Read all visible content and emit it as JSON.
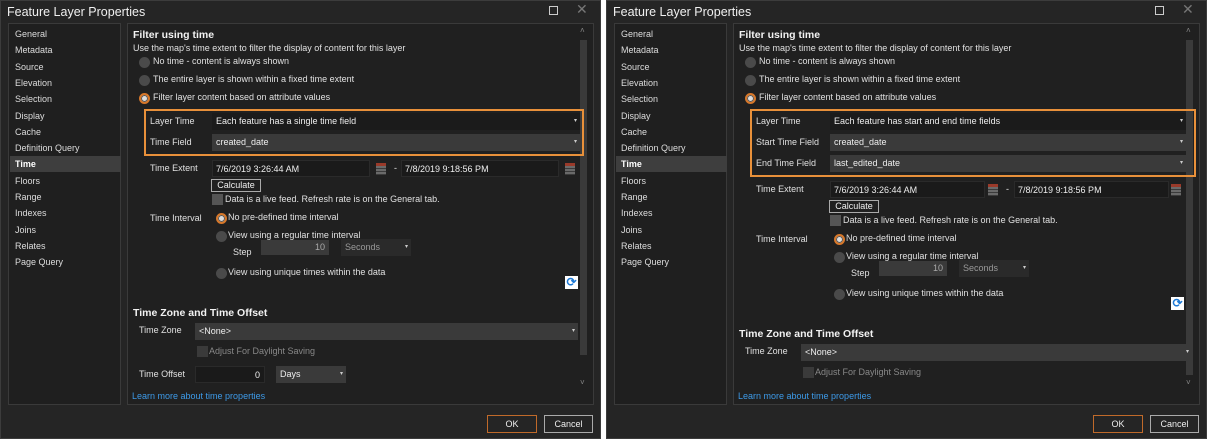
{
  "dialogs": [
    {
      "title": "Feature Layer Properties",
      "sidebar": [
        "General",
        "Metadata",
        "Source",
        "Elevation",
        "Selection",
        "Display",
        "Cache",
        "Definition Query",
        "Time",
        "Floors",
        "Range",
        "Indexes",
        "Joins",
        "Relates",
        "Page Query"
      ],
      "selected": "Time",
      "filter_heading": "Filter using time",
      "filter_desc": "Use the map's time extent to filter the display of content for this layer",
      "modes": [
        "No time - content is always shown",
        "The entire layer is shown within a fixed time extent",
        "Filter layer content based on attribute values"
      ],
      "fields": [
        {
          "label": "Layer Time",
          "value": "Each feature has a single time field"
        },
        {
          "label": "Time Field",
          "value": "created_date"
        }
      ],
      "time_extent_label": "Time Extent",
      "start": "7/6/2019 3:26:44 AM",
      "dash": "-",
      "end": "7/8/2019 9:18:56 PM",
      "calculate": "Calculate",
      "live_feed": "Data is a live feed. Refresh rate is on the General tab.",
      "interval_label": "Time Interval",
      "interval_options": [
        "No pre-defined time interval",
        "View using a regular time interval",
        "View using unique times within the data"
      ],
      "step_label": "Step",
      "step_value": "10",
      "step_unit": "Seconds",
      "tz_heading": "Time Zone and Time Offset",
      "tz_label": "Time Zone",
      "tz_value": "<None>",
      "dst": "Adjust For Daylight Saving",
      "offset_label": "Time Offset",
      "offset_value": "0",
      "offset_unit": "Days",
      "learn_more": "Learn more about time properties",
      "ok": "OK",
      "cancel": "Cancel"
    },
    {
      "title": "Feature Layer Properties",
      "sidebar": [
        "General",
        "Metadata",
        "Source",
        "Elevation",
        "Selection",
        "Display",
        "Cache",
        "Definition Query",
        "Time",
        "Floors",
        "Range",
        "Indexes",
        "Joins",
        "Relates",
        "Page Query"
      ],
      "selected": "Time",
      "filter_heading": "Filter using time",
      "filter_desc": "Use the map's time extent to filter the display of content for this layer",
      "modes": [
        "No time - content is always shown",
        "The entire layer is shown within a fixed time extent",
        "Filter layer content based on attribute values"
      ],
      "fields": [
        {
          "label": "Layer Time",
          "value": "Each feature has start and end time fields"
        },
        {
          "label": "Start Time Field",
          "value": "created_date"
        },
        {
          "label": "End Time Field",
          "value": "last_edited_date"
        }
      ],
      "time_extent_label": "Time Extent",
      "start": "7/6/2019 3:26:44 AM",
      "dash": "-",
      "end": "7/8/2019 9:18:56 PM",
      "calculate": "Calculate",
      "live_feed": "Data is a live feed. Refresh rate is on the General tab.",
      "interval_label": "Time Interval",
      "interval_options": [
        "No pre-defined time interval",
        "View using a regular time interval",
        "View using unique times within the data"
      ],
      "step_label": "Step",
      "step_value": "10",
      "step_unit": "Seconds",
      "tz_heading": "Time Zone and Time Offset",
      "tz_label": "Time Zone",
      "tz_value": "<None>",
      "dst": "Adjust For Daylight Saving",
      "learn_more": "Learn more about time properties",
      "ok": "OK",
      "cancel": "Cancel"
    }
  ],
  "icons": {
    "maximize": "maximize-icon",
    "close": "close-icon",
    "calendar": "calendar-icon",
    "refresh": "refresh-icon",
    "dropdown": "chevron-down-icon"
  },
  "colors": {
    "accent": "#e8903a",
    "link": "#3d9ae8",
    "background": "#252525"
  }
}
